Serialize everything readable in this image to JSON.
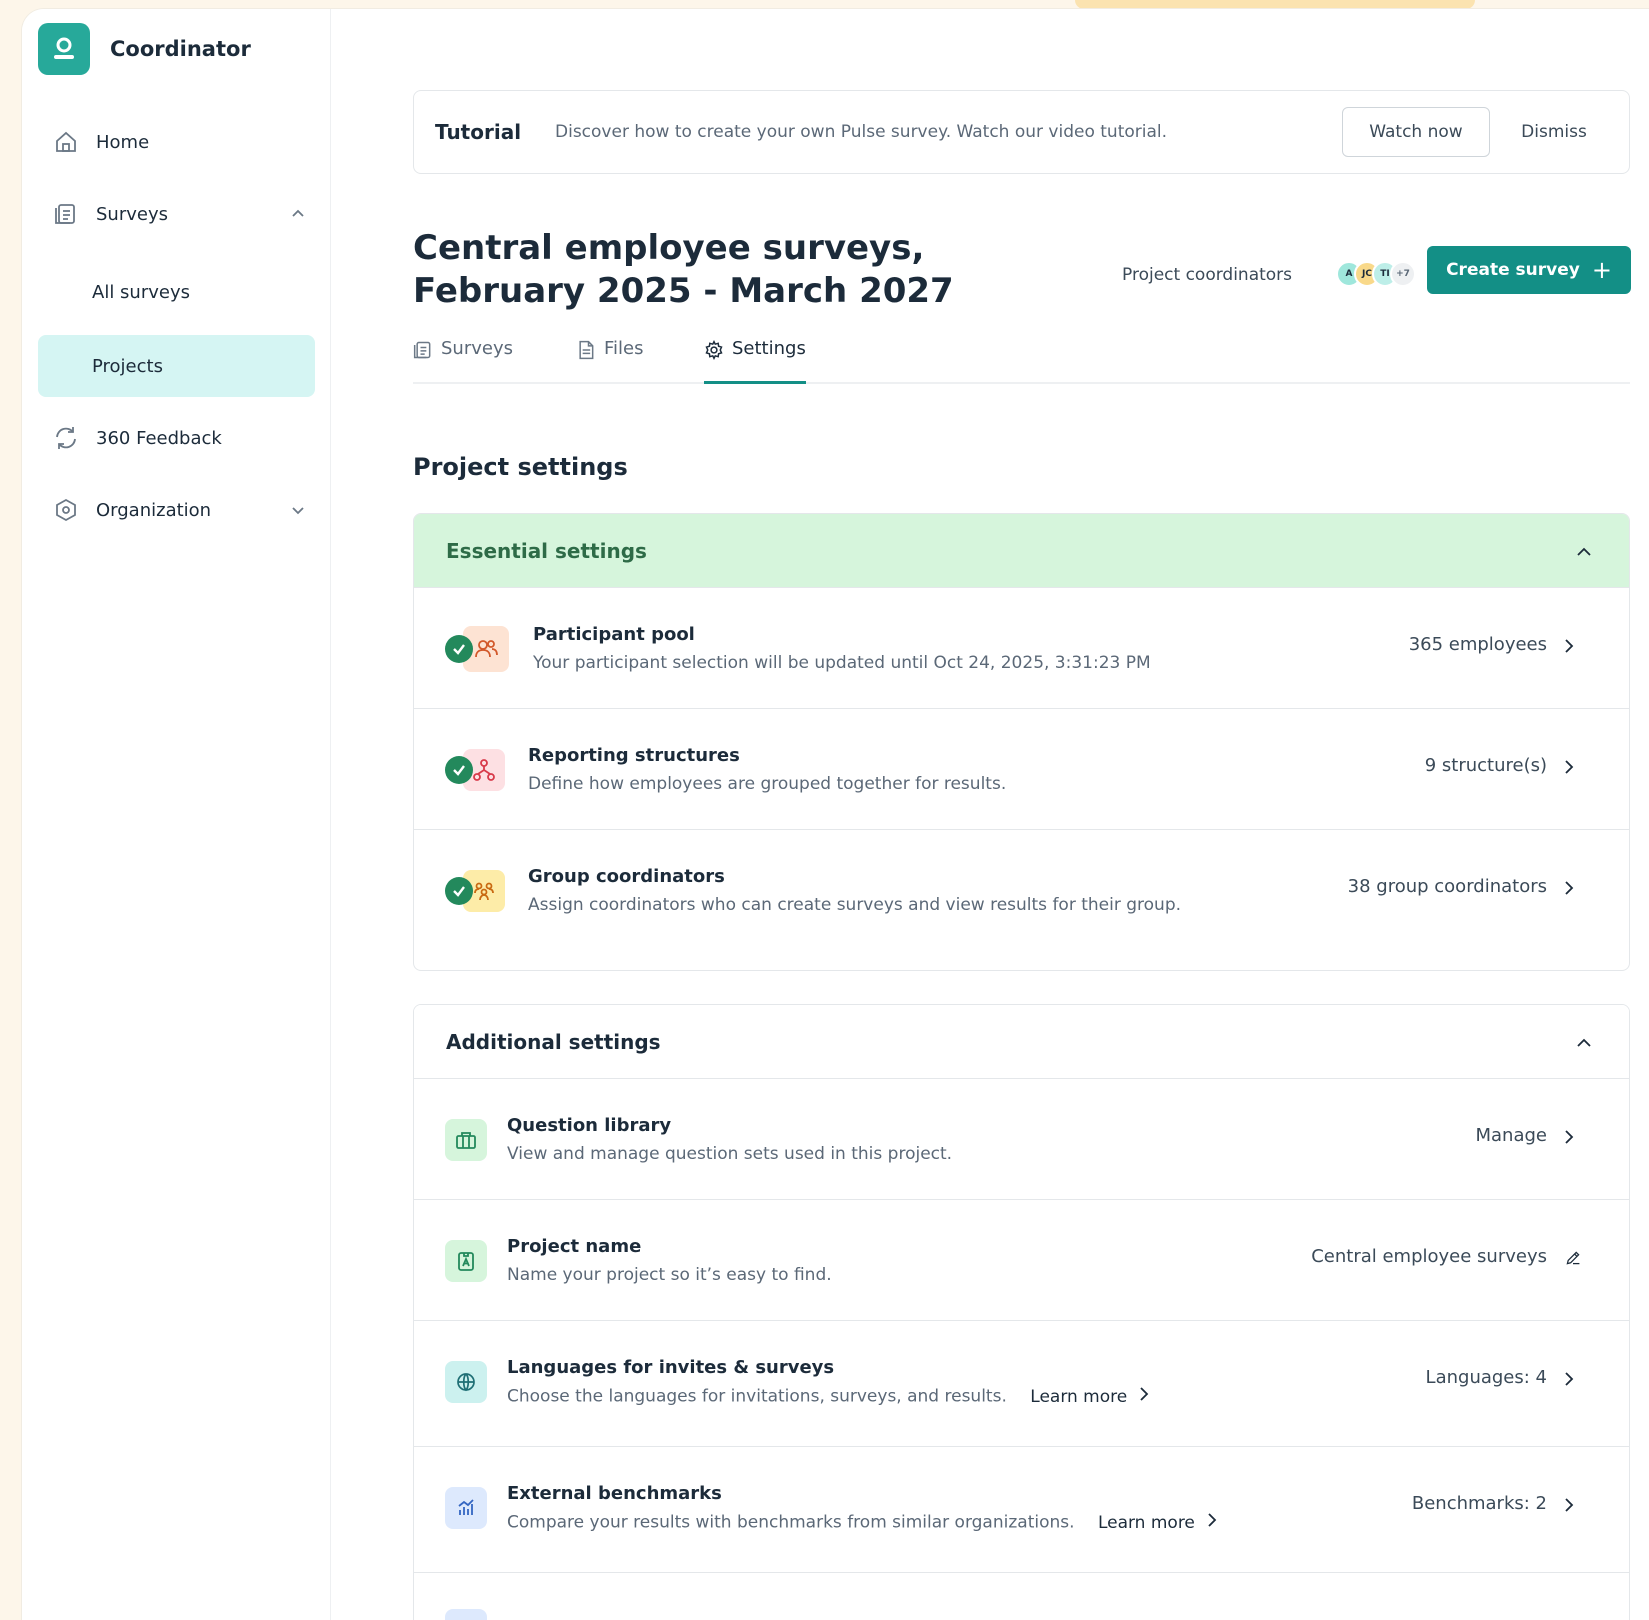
{
  "app": {
    "name": "Coordinator"
  },
  "sidebar": {
    "items": [
      {
        "label": "Home",
        "icon": "home-icon"
      },
      {
        "label": "Surveys",
        "icon": "surveys-icon",
        "expanded": true
      },
      {
        "label": "All surveys"
      },
      {
        "label": "Projects",
        "active": true
      },
      {
        "label": "360 Feedback",
        "icon": "refresh-icon"
      },
      {
        "label": "Organization",
        "icon": "organization-icon",
        "expanded": false
      }
    ]
  },
  "tutorial": {
    "title": "Tutorial",
    "text": "Discover how to create your own Pulse survey. Watch our video tutorial.",
    "watch_label": "Watch now",
    "dismiss_label": "Dismiss"
  },
  "project": {
    "title": "Central employee surveys, February 2025 - March 2027",
    "coordinators_label": "Project coordinators",
    "avatars": [
      "A",
      "JC",
      "TI",
      "+7"
    ],
    "create_label": "Create survey"
  },
  "tabs": [
    {
      "label": "Surveys",
      "icon": "surveys-icon"
    },
    {
      "label": "Files",
      "icon": "file-icon"
    },
    {
      "label": "Settings",
      "icon": "gear-icon",
      "active": true
    }
  ],
  "settings": {
    "title": "Project settings",
    "essential": {
      "header": "Essential settings",
      "rows": [
        {
          "title": "Participant pool",
          "desc": "Your participant selection will be updated until Oct 24, 2025, 3:31:23 PM",
          "value": "365 employees",
          "icon": "people-icon",
          "status": "complete"
        },
        {
          "title": "Reporting structures",
          "desc": "Define how employees are grouped together for results.",
          "value": "9 structure(s)",
          "icon": "hierarchy-icon",
          "status": "complete"
        },
        {
          "title": "Group coordinators",
          "desc": "Assign coordinators who can create surveys and view results for their group.",
          "value": "38 group coordinators",
          "icon": "group-icon",
          "status": "complete"
        }
      ]
    },
    "additional": {
      "header": "Additional settings",
      "rows": [
        {
          "title": "Question library",
          "desc": "View and manage question sets used in this project.",
          "value": "Manage",
          "icon": "library-icon"
        },
        {
          "title": "Project name",
          "desc": "Name your project so it’s easy to find.",
          "value": "Central employee surveys",
          "icon": "name-tag-icon",
          "action_icon": "pencil-icon"
        },
        {
          "title": "Languages for invites & surveys",
          "desc": "Choose the languages for invitations, surveys, and results.",
          "link": "Learn more",
          "value": "Languages: 4",
          "icon": "globe-icon"
        },
        {
          "title": "External benchmarks",
          "desc": "Compare your results with benchmarks from similar organizations.",
          "link": "Learn more",
          "value": "Benchmarks: 2",
          "icon": "benchmark-icon"
        }
      ]
    }
  },
  "colors": {
    "accent": "#138f86",
    "brand": "#27a99a",
    "active_nav": "#d5f5f3",
    "essential_header": "#d6f5dc",
    "check": "#23895c"
  }
}
